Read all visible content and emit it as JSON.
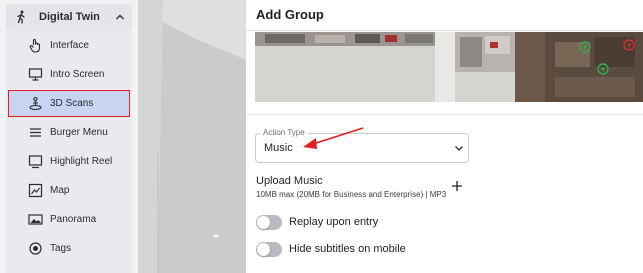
{
  "sidebar": {
    "header": {
      "label": "Digital Twin",
      "icon": "person-walking-icon"
    },
    "items": [
      {
        "label": "Interface",
        "icon": "hand-pointer-icon"
      },
      {
        "label": "Intro Screen",
        "icon": "monitor-icon"
      },
      {
        "label": "3D Scans",
        "icon": "scan-person-icon",
        "active": true
      },
      {
        "label": "Burger Menu",
        "icon": "hamburger-menu-icon"
      },
      {
        "label": "Highlight Reel",
        "icon": "play-screen-icon"
      },
      {
        "label": "Map",
        "icon": "map-icon"
      },
      {
        "label": "Panorama",
        "icon": "panorama-icon"
      },
      {
        "label": "Tags",
        "icon": "tag-target-icon"
      }
    ]
  },
  "panel": {
    "title": "Add Group",
    "action_type": {
      "legend": "Action Type",
      "value": "Music"
    },
    "upload": {
      "title": "Upload Music",
      "subtitle": "10MB max (20MB for Business and Enterprise) | MP3"
    },
    "toggles": [
      {
        "label": "Replay upon entry",
        "on": false
      },
      {
        "label": "Hide subtitles on mobile",
        "on": false
      }
    ]
  },
  "colors": {
    "active_bg": "#c9d3f2",
    "highlight_border": "#e41e1e",
    "annotation_arrow": "#e41e1e",
    "toggle_off": "#b8bbc2"
  }
}
